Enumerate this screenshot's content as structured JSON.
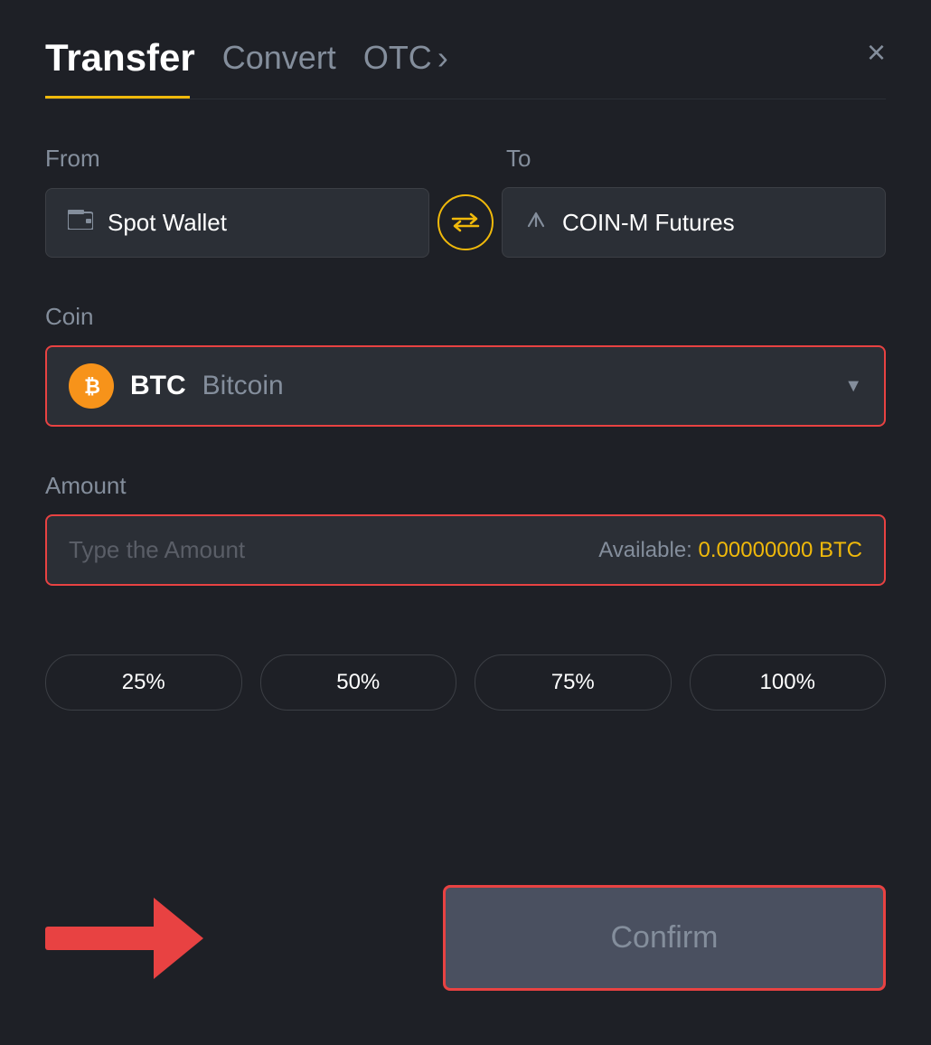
{
  "header": {
    "title": "Transfer",
    "tab_convert": "Convert",
    "tab_otc": "OTC",
    "tab_otc_arrow": "›",
    "close_icon": "×"
  },
  "from": {
    "label": "From",
    "wallet_icon": "▬",
    "wallet_name": "Spot Wallet"
  },
  "swap": {
    "icon": "⇄"
  },
  "to": {
    "label": "To",
    "futures_icon": "↑",
    "futures_name": "COIN-M Futures"
  },
  "coin": {
    "label": "Coin",
    "symbol": "BTC",
    "name": "Bitcoin",
    "btc_letter": "₿"
  },
  "amount": {
    "label": "Amount",
    "placeholder": "Type the Amount",
    "available_label": "Available:",
    "available_value": "0.00000000 BTC"
  },
  "percent_buttons": [
    "25%",
    "50%",
    "75%",
    "100%"
  ],
  "confirm_button": "Confirm"
}
